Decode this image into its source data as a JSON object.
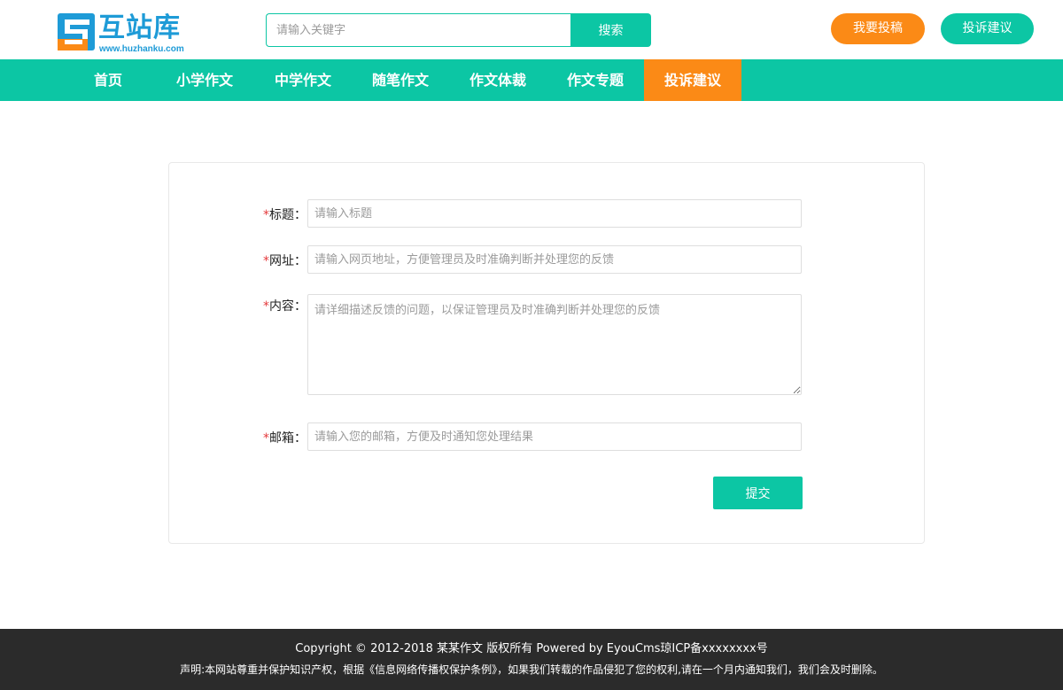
{
  "brand": {
    "name": "互站库",
    "url": "www.huzhanku.com",
    "colors": {
      "primary": "#0cc6a4",
      "accent": "#fb8a16",
      "logo": "#1e9bd7"
    }
  },
  "search": {
    "placeholder": "请输入关键字",
    "button_label": "搜索",
    "icon": "search-icon"
  },
  "header_actions": {
    "submit_article": "我要投稿",
    "complaint": "投诉建议"
  },
  "nav": {
    "items": [
      {
        "label": "首页",
        "active": false
      },
      {
        "label": "小学作文",
        "active": false
      },
      {
        "label": "中学作文",
        "active": false
      },
      {
        "label": "随笔作文",
        "active": false
      },
      {
        "label": "作文体裁",
        "active": false
      },
      {
        "label": "作文专题",
        "active": false
      },
      {
        "label": "投诉建议",
        "active": true
      }
    ]
  },
  "form": {
    "required_mark": "*",
    "fields": {
      "title": {
        "label": "标题：",
        "placeholder": "请输入标题",
        "value": ""
      },
      "url": {
        "label": "网址：",
        "placeholder": "请输入网页地址，方便管理员及时准确判断并处理您的反馈",
        "value": ""
      },
      "content": {
        "label": "内容：",
        "placeholder": "请详细描述反馈的问题，以保证管理员及时准确判断并处理您的反馈",
        "value": ""
      },
      "email": {
        "label": "邮箱：",
        "placeholder": "请输入您的邮箱，方便及时通知您处理结果",
        "value": ""
      }
    },
    "submit_label": "提交"
  },
  "footer": {
    "copyright": "Copyright © 2012-2018 某某作文 版权所有 Powered by EyouCms琼ICP备xxxxxxxx号",
    "disclaimer": "声明:本网站尊重并保护知识产权，根据《信息网络传播权保护条例》，如果我们转载的作品侵犯了您的权利,请在一个月内通知我们，我们会及时删除。"
  }
}
